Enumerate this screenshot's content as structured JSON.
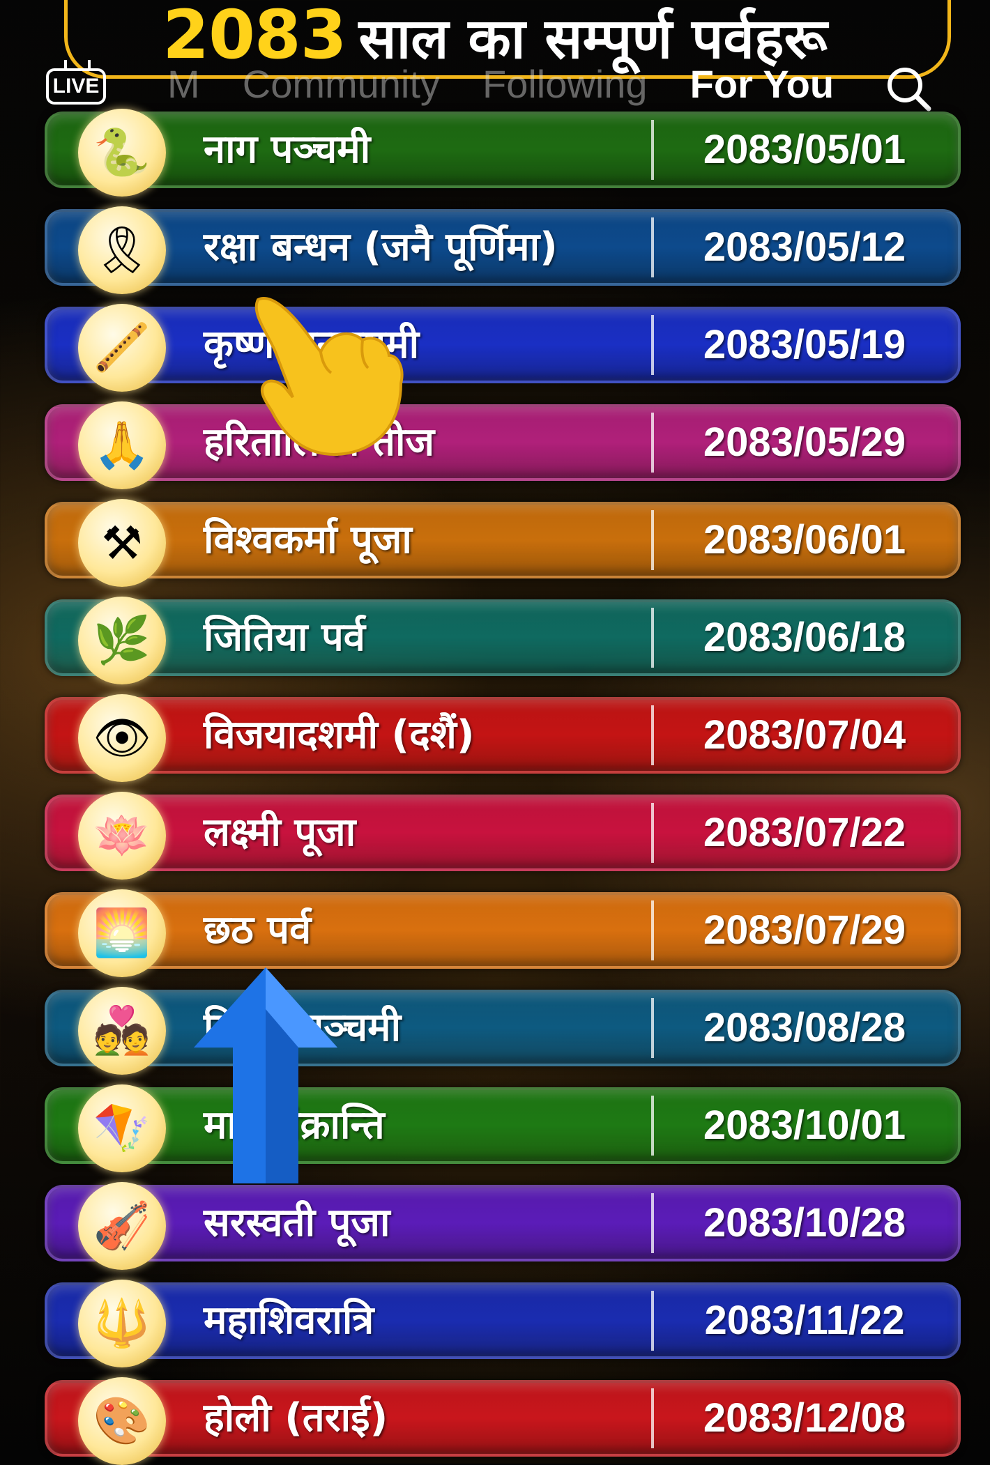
{
  "title": {
    "year": "2083",
    "rest": "साल का सम्पूर्ण पर्वहरू"
  },
  "topbar": {
    "live_label": "LIVE",
    "tabs": [
      "M",
      "Community",
      "Following",
      "For You"
    ],
    "active_tab": "For You"
  },
  "festivals": [
    {
      "name": "नाग पञ्चमी",
      "date": "2083/05/01",
      "color": "#1e6b12",
      "icon": "cobra-icon"
    },
    {
      "name": "रक्षा बन्धन (जनै पूर्णिमा)",
      "date": "2083/05/12",
      "color": "#0d4a8c",
      "icon": "rakhi-icon"
    },
    {
      "name": "कृष्ण जन्माष्टमी",
      "date": "2083/05/19",
      "color": "#1a2fc4",
      "icon": "krishna-icon"
    },
    {
      "name": "हरितालिका तीज",
      "date": "2083/05/29",
      "color": "#b0207a",
      "icon": "woman-praying-icon"
    },
    {
      "name": "विश्वकर्मा पूजा",
      "date": "2083/06/01",
      "color": "#c96f0c",
      "icon": "tools-icon"
    },
    {
      "name": "जितिया पर्व",
      "date": "2083/06/18",
      "color": "#0f6a60",
      "icon": "woman-with-plant-icon"
    },
    {
      "name": "विजयादशमी (दशैं)",
      "date": "2083/07/04",
      "color": "#c41414",
      "icon": "durga-icon"
    },
    {
      "name": "लक्ष्मी पूजा",
      "date": "2083/07/22",
      "color": "#c8123e",
      "icon": "lakshmi-icon"
    },
    {
      "name": "छठ पर्व",
      "date": "2083/07/29",
      "color": "#d9700f",
      "icon": "sunrise-icon"
    },
    {
      "name": "विवाह पञ्चमी",
      "date": "2083/08/28",
      "color": "#0d5a80",
      "icon": "couple-icon"
    },
    {
      "name": "माघे संक्रान्ति",
      "date": "2083/10/01",
      "color": "#1e7a14",
      "icon": "kite-icon"
    },
    {
      "name": "सरस्वती पूजा",
      "date": "2083/10/28",
      "color": "#5b1cb8",
      "icon": "saraswati-icon"
    },
    {
      "name": "महाशिवरात्रि",
      "date": "2083/11/22",
      "color": "#1a2cb0",
      "icon": "shiva-icon"
    },
    {
      "name": "होली (तराई)",
      "date": "2083/12/08",
      "color": "#c9161c",
      "icon": "holi-colors-icon"
    }
  ]
}
